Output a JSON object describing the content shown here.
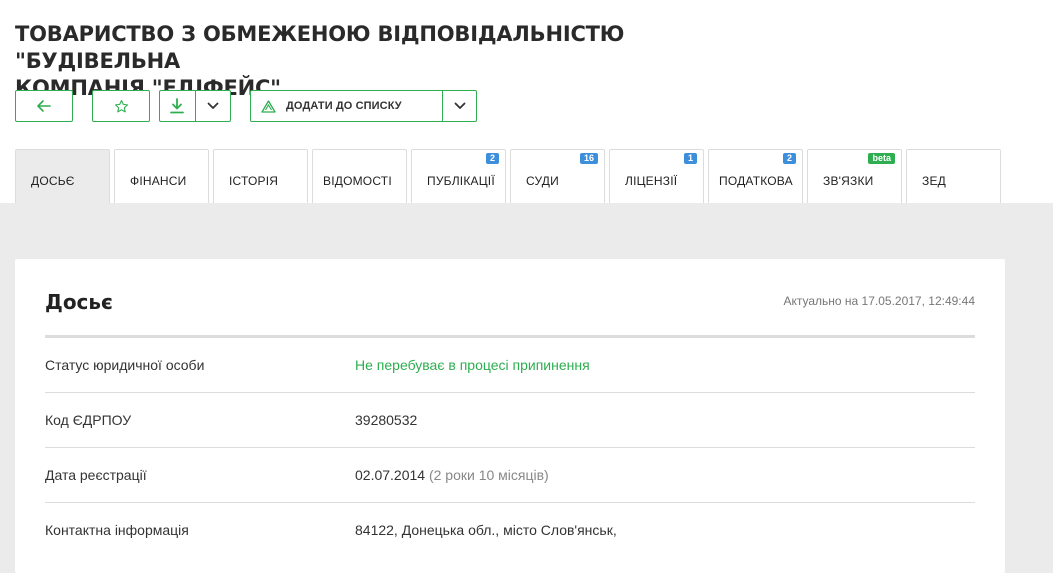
{
  "company": {
    "title_line1": "ТОВАРИСТВО З ОБМЕЖЕНОЮ ВІДПОВІДАЛЬНІСТЮ \"БУДІВЕЛЬНА",
    "title_line2": "КОМПАНІЯ \"ЕДІФЕЙС\""
  },
  "toolbar": {
    "add_to_list_label": "ДОДАТИ ДО СПИСКУ",
    "accent_color": "#2eae50",
    "icons": [
      "arrow-left-icon",
      "star-icon",
      "download-icon",
      "chevron-down-icon",
      "alarm-triangle-icon"
    ]
  },
  "tabs": [
    {
      "label": "ДОСЬЄ",
      "active": true,
      "badge": ""
    },
    {
      "label": "ФІНАНСИ",
      "badge": ""
    },
    {
      "label": "ІСТОРІЯ",
      "badge": ""
    },
    {
      "label": "ВІДОМОСТІ",
      "badge": ""
    },
    {
      "label": "ПУБЛІКАЦІЇ",
      "badge": "2"
    },
    {
      "label": "СУДИ",
      "badge": "16"
    },
    {
      "label": "ЛІЦЕНЗІЇ",
      "badge": "1"
    },
    {
      "label": "ПОДАТКОВА",
      "badge": "2"
    },
    {
      "label": "ЗВ'ЯЗКИ",
      "badge": "beta"
    },
    {
      "label": "ЗЕД",
      "badge": ""
    }
  ],
  "dossier": {
    "title": "Досьє",
    "updated": "Актуально на 17.05.2017, 12:49:44",
    "rows": [
      {
        "label": "Статус юридичної особи",
        "value": "Не перебуває в процесі припинення",
        "status_color": "#2eae50"
      },
      {
        "label": "Код ЄДРПОУ",
        "value": "39280532"
      },
      {
        "label": "Дата реєстрації",
        "value": "02.07.2014",
        "extra": "(2 роки 10 місяців)"
      },
      {
        "label": "Контактна інформація",
        "value": "84122, Донецька обл., місто Слов'янськ,"
      }
    ]
  }
}
